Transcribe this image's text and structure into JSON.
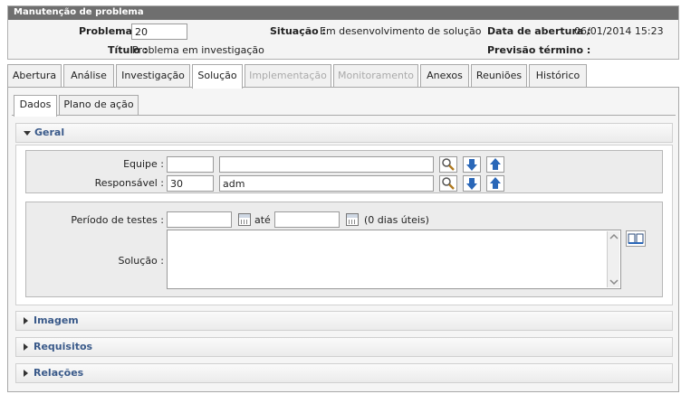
{
  "header": {
    "title": "Manutenção de problema",
    "problema_label": "Problema :",
    "problema_value": "20",
    "titulo_label": "Título :",
    "titulo_value": "Problema em investigação",
    "situacao_label": "Situação :",
    "situacao_value": "Em desenvolvimento de solução",
    "abertura_label": "Data de abertura :",
    "abertura_value": "06/01/2014 15:23",
    "previsao_label": "Previsão término :"
  },
  "tabs": [
    {
      "label": "Abertura"
    },
    {
      "label": "Análise"
    },
    {
      "label": "Investigação"
    },
    {
      "label": "Solução"
    },
    {
      "label": "Implementação"
    },
    {
      "label": "Monitoramento"
    },
    {
      "label": "Anexos"
    },
    {
      "label": "Reuniões"
    },
    {
      "label": "Histórico"
    }
  ],
  "subtabs": [
    {
      "label": "Dados"
    },
    {
      "label": "Plano de ação"
    }
  ],
  "sections": {
    "geral": "Geral",
    "imagem": "Imagem",
    "requisitos": "Requisitos",
    "relacoes": "Relações"
  },
  "form": {
    "equipe_label": "Equipe :",
    "equipe_code": "",
    "equipe_name": "",
    "responsavel_label": "Responsável :",
    "responsavel_code": "30",
    "responsavel_name": "adm",
    "periodo_label": "Período de testes :",
    "periodo_start": "",
    "ate_label": "até",
    "periodo_end": "",
    "dias_uteis": "(0 dias úteis)",
    "solucao_label": "Solução :",
    "solucao_value": ""
  },
  "colors": {
    "header_bar": "#6f6f6f",
    "section_title": "#3a5a8a",
    "icon_blue": "#2a67b8"
  }
}
